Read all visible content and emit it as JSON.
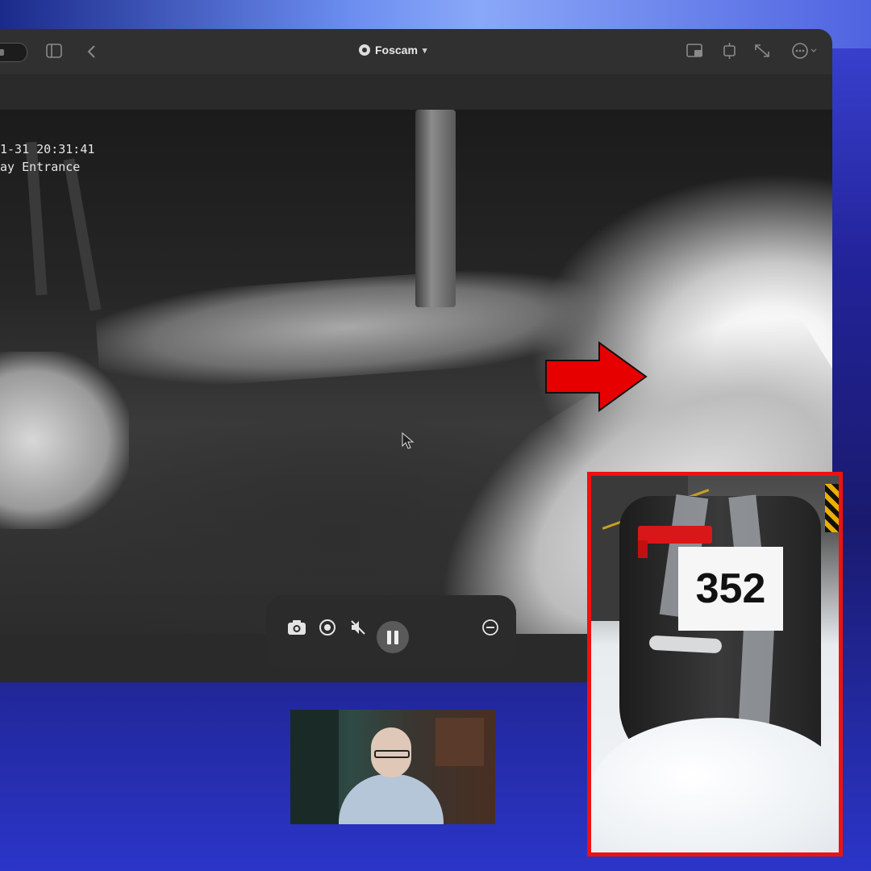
{
  "app": {
    "title": "Foscam",
    "title_chevron": "▾"
  },
  "titlebar": {
    "left_icons": [
      "toggle-pill-icon",
      "sidebar-icon",
      "back-chevron-icon"
    ],
    "right_icons": [
      "picture-in-picture-icon",
      "refresh-icon",
      "expand-icon",
      "more-icon"
    ]
  },
  "video": {
    "timestamp": "1-31 20:31:41",
    "camera_name": "ay Entrance"
  },
  "controls": {
    "icons": [
      "camera-snapshot-icon",
      "record-icon",
      "mute-icon",
      "pause-icon",
      "more-options-icon"
    ]
  },
  "mailbox": {
    "number": "352"
  },
  "colors": {
    "highlight_red": "#e11111",
    "background_blue": "#23239a"
  }
}
